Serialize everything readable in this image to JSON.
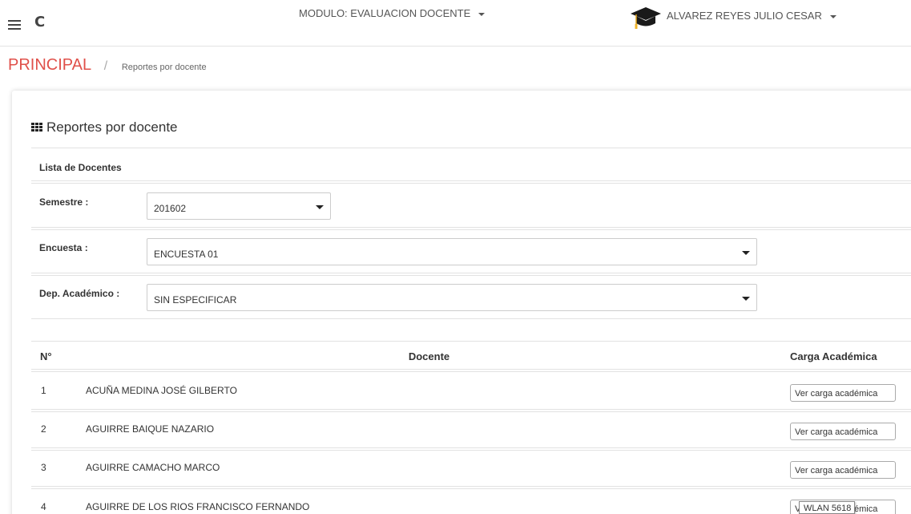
{
  "topbar": {
    "module_label": "MODULO: EVALUACION DOCENTE",
    "user_name": "ALVAREZ REYES JULIO CESAR"
  },
  "breadcrumb": {
    "home": "PRINCIPAL",
    "separator": "/",
    "current": "Reportes por docente"
  },
  "panel": {
    "title": "Reportes por docente",
    "list_heading": "Lista de Docentes"
  },
  "filters": {
    "semestre": {
      "label": "Semestre :",
      "value": "201602"
    },
    "encuesta": {
      "label": "Encuesta :",
      "value": "ENCUESTA 01"
    },
    "departamento": {
      "label": "Dep. Académico :",
      "value": "SIN ESPECIFICAR"
    }
  },
  "table": {
    "headers": [
      "N°",
      "Docente",
      "Carga Académica"
    ],
    "rows": [
      {
        "n": "1",
        "docente": "ACUÑA MEDINA JOSÉ GILBERTO",
        "action": "Ver carga académica"
      },
      {
        "n": "2",
        "docente": "AGUIRRE BAIQUE NAZARIO",
        "action": "Ver carga académica"
      },
      {
        "n": "3",
        "docente": "AGUIRRE CAMACHO MARCO",
        "action": "Ver carga académica"
      },
      {
        "n": "4",
        "docente": "AGUIRRE DE LOS RIOS FRANCISCO FERNANDO",
        "action": "Ver carga académica"
      }
    ]
  },
  "tooltip": "WLAN 5618",
  "colors": {
    "brand_red": "#e0504a",
    "border": "#e2e2e2"
  },
  "icons": [
    "menu-icon",
    "refresh-icon",
    "caret-down-icon",
    "graduation-cap-icon",
    "grid-icon"
  ]
}
